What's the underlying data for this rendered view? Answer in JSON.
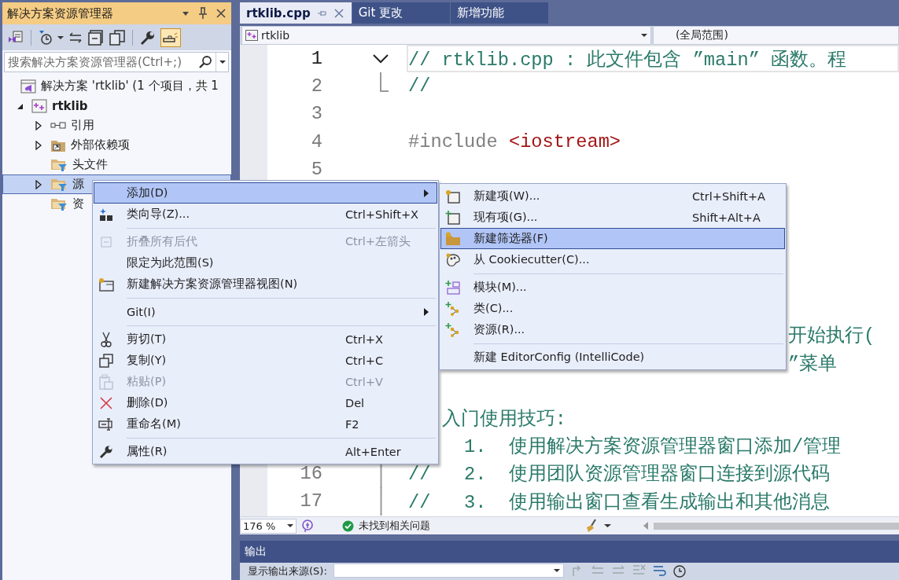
{
  "explorer": {
    "title": "解决方案资源管理器",
    "preview_toggle": {
      "on": true
    },
    "search": {
      "placeholder": "搜索解决方案资源管理器(Ctrl+;)"
    },
    "tree": [
      {
        "kind": "solution",
        "label": "解决方案 'rtklib' (1 个项目，共 1",
        "selected": false,
        "children": [
          {
            "kind": "project",
            "label": "rtklib",
            "expanded": true,
            "selected": false,
            "children": [
              {
                "kind": "references",
                "label": "引用",
                "expanded": false,
                "selected": false
              },
              {
                "kind": "external",
                "label": "外部依赖项",
                "expanded": false,
                "selected": false
              },
              {
                "kind": "filter",
                "label": "头文件",
                "selected": false
              },
              {
                "kind": "filter",
                "label": "源",
                "expanded": false,
                "selected": true
              },
              {
                "kind": "filter",
                "label": "资",
                "selected": false
              }
            ]
          }
        ]
      }
    ]
  },
  "tabs": [
    {
      "label": "rtklib.cpp",
      "selected": true
    },
    {
      "label": "Git 更改",
      "selected": false
    },
    {
      "label": "新增功能",
      "selected": false
    }
  ],
  "navigation": {
    "project": "rtklib",
    "scope": "(全局范围)"
  },
  "editor": {
    "lines": [
      {
        "kind": "code",
        "number": "1",
        "fold": {
          "kind": "start"
        },
        "current": true,
        "tokens": [
          {
            "kind": "comment",
            "text": "// rtklib.cpp : 此文件包含 ”main” 函数。程"
          }
        ]
      },
      {
        "kind": "code",
        "number": "2",
        "fold": {
          "kind": "end"
        },
        "current": false,
        "tokens": [
          {
            "kind": "comment",
            "text": "//"
          }
        ]
      },
      {
        "kind": "code",
        "number": "3",
        "current": false
      },
      {
        "kind": "code",
        "number": "4",
        "current": false,
        "tokens": [
          {
            "kind": "directive",
            "text": "#include "
          },
          {
            "kind": "header",
            "text": "<iostream>"
          }
        ]
      },
      {
        "kind": "code",
        "number": "5",
        "current": false
      },
      {
        "kind": "blank"
      },
      {
        "kind": "blank"
      },
      {
        "kind": "blank"
      },
      {
        "kind": "blank"
      },
      {
        "kind": "blank"
      },
      {
        "kind": "tail-submenu",
        "current": false,
        "tokens": [
          {
            "kind": "comment",
            "text": "开始执行("
          }
        ]
      },
      {
        "kind": "tail-submenu",
        "current": false,
        "tokens": [
          {
            "kind": "comment",
            "text": "”菜单"
          }
        ]
      },
      {
        "kind": "blank"
      },
      {
        "kind": "tail-menu",
        "current": false,
        "tokens": [
          {
            "kind": "comment",
            "text": "入门使用技巧:"
          }
        ]
      },
      {
        "kind": "tail-list",
        "current": false,
        "tokens": [
          {
            "kind": "comment",
            "text": "1.  使用解决方案资源管理器窗口添加/管理"
          }
        ]
      },
      {
        "kind": "code",
        "number": "16",
        "fold": {
          "kind": "body"
        },
        "current": false,
        "tokens": [
          {
            "kind": "comment",
            "text": "//   2.  使用团队资源管理器窗口连接到源代码"
          }
        ]
      },
      {
        "kind": "code",
        "number": "17",
        "fold": {
          "kind": "body"
        },
        "current": false,
        "tokens": [
          {
            "kind": "comment",
            "text": "//   3.  使用输出窗口查看生成输出和其他消息"
          }
        ]
      }
    ]
  },
  "status": {
    "zoom": "176 %",
    "issues": "未找到相关问题"
  },
  "output": {
    "title": "输出",
    "source_label": "显示输出来源(S):"
  },
  "context_menu": {
    "items": [
      {
        "kind": "item",
        "label": "添加(D)",
        "submenu": true,
        "selected": true,
        "disabled": false
      },
      {
        "kind": "item",
        "label": "类向导(Z)...",
        "shortcut": "Ctrl+Shift+X",
        "submenu": false,
        "selected": false,
        "disabled": false
      },
      {
        "kind": "separator"
      },
      {
        "kind": "item",
        "label": "折叠所有后代",
        "shortcut": "Ctrl+左箭头",
        "submenu": false,
        "selected": false,
        "disabled": true
      },
      {
        "kind": "item",
        "label": "限定为此范围(S)",
        "submenu": false,
        "selected": false,
        "disabled": false
      },
      {
        "kind": "item",
        "label": "新建解决方案资源管理器视图(N)",
        "submenu": false,
        "selected": false,
        "disabled": false
      },
      {
        "kind": "separator"
      },
      {
        "kind": "item",
        "label": "Git(I)",
        "submenu": true,
        "selected": false,
        "disabled": false
      },
      {
        "kind": "separator"
      },
      {
        "kind": "item",
        "label": "剪切(T)",
        "shortcut": "Ctrl+X",
        "submenu": false,
        "selected": false,
        "disabled": false
      },
      {
        "kind": "item",
        "label": "复制(Y)",
        "shortcut": "Ctrl+C",
        "submenu": false,
        "selected": false,
        "disabled": false
      },
      {
        "kind": "item",
        "label": "粘贴(P)",
        "shortcut": "Ctrl+V",
        "submenu": false,
        "selected": false,
        "disabled": true
      },
      {
        "kind": "item",
        "label": "删除(D)",
        "shortcut": "Del",
        "submenu": false,
        "selected": false,
        "disabled": false
      },
      {
        "kind": "item",
        "label": "重命名(M)",
        "shortcut": "F2",
        "submenu": false,
        "selected": false,
        "disabled": false
      },
      {
        "kind": "separator"
      },
      {
        "kind": "item",
        "label": "属性(R)",
        "shortcut": "Alt+Enter",
        "submenu": false,
        "selected": false,
        "disabled": false
      }
    ]
  },
  "add_submenu": {
    "items": [
      {
        "kind": "item",
        "label": "新建项(W)...",
        "shortcut": "Ctrl+Shift+A",
        "submenu": false,
        "selected": false,
        "disabled": false
      },
      {
        "kind": "item",
        "label": "现有项(G)...",
        "shortcut": "Shift+Alt+A",
        "submenu": false,
        "selected": false,
        "disabled": false
      },
      {
        "kind": "item",
        "label": "新建筛选器(F)",
        "submenu": false,
        "selected": true,
        "disabled": false
      },
      {
        "kind": "item",
        "label": "从 Cookiecutter(C)...",
        "submenu": false,
        "selected": false,
        "disabled": false
      },
      {
        "kind": "separator"
      },
      {
        "kind": "item",
        "label": "模块(M)...",
        "submenu": false,
        "selected": false,
        "disabled": false
      },
      {
        "kind": "item",
        "label": "类(C)...",
        "submenu": false,
        "selected": false,
        "disabled": false
      },
      {
        "kind": "item",
        "label": "资源(R)...",
        "submenu": false,
        "selected": false,
        "disabled": false
      },
      {
        "kind": "separator"
      },
      {
        "kind": "item",
        "label": "新建 EditorConfig (IntelliCode)",
        "submenu": false,
        "selected": false,
        "disabled": false
      }
    ]
  }
}
